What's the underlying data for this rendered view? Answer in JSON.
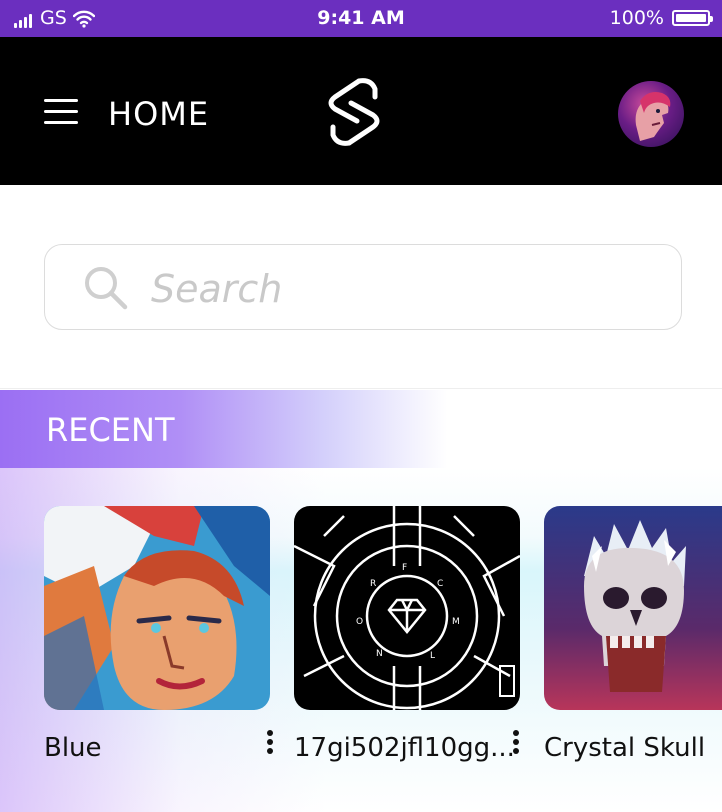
{
  "status_bar": {
    "carrier": "GS",
    "time": "9:41 AM",
    "battery": "100%"
  },
  "header": {
    "title": "HOME",
    "menu_icon": "hamburger-menu-icon",
    "logo_icon": "brand-logo",
    "avatar_icon": "user-avatar"
  },
  "search": {
    "placeholder": "Search",
    "value": ""
  },
  "recent": {
    "title": "RECENT",
    "items": [
      {
        "label": "Blue"
      },
      {
        "label": "17gi502jfl10gg..."
      },
      {
        "label": "Crystal Skull"
      }
    ]
  },
  "colors": {
    "status_bar": "#6b2fbf",
    "header_bg": "#000000",
    "accent_purple": "#9b6ff3"
  }
}
